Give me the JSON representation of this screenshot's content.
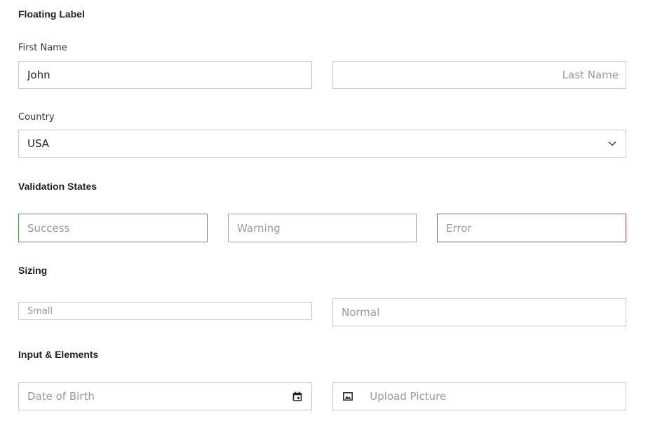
{
  "sections": {
    "floating_label": "Floating Label",
    "validation": "Validation States",
    "sizing": "Sizing",
    "input_elements": "Input & Elements"
  },
  "floating": {
    "first_name_label": "First Name",
    "first_name_value": "John",
    "last_name_placeholder": "Last Name",
    "country_label": "Country",
    "country_value": "USA"
  },
  "validation": {
    "success_placeholder": "Success",
    "warning_placeholder": "Warning",
    "error_placeholder": "Error",
    "colors": {
      "success": "#4a9a4a",
      "warning": "#e8875a",
      "error": "#c94444"
    }
  },
  "sizing": {
    "small_placeholder": "Small",
    "normal_placeholder": "Normal"
  },
  "elements": {
    "dob_placeholder": "Date of Birth",
    "dob_icon": "calendar-icon",
    "upload_placeholder": "Upload Picture",
    "upload_icon": "image-icon"
  }
}
